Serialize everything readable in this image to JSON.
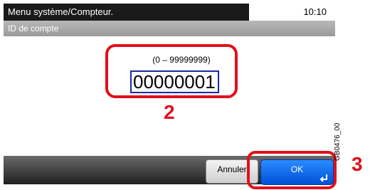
{
  "header": {
    "title": "Menu système/Compteur.",
    "time": "10:10"
  },
  "subheader": {
    "title": "ID de compte"
  },
  "input": {
    "range": "(0 – 99999999)",
    "value": "00000001"
  },
  "buttons": {
    "cancel_label": "Annuler",
    "ok_label": "OK"
  },
  "annotations": {
    "step2": "2",
    "step3": "3",
    "figure_code": "GB0476_00"
  },
  "colors": {
    "highlight": "#e0101a",
    "ok_button": "#0050d8",
    "header": "#1a1a1a"
  }
}
